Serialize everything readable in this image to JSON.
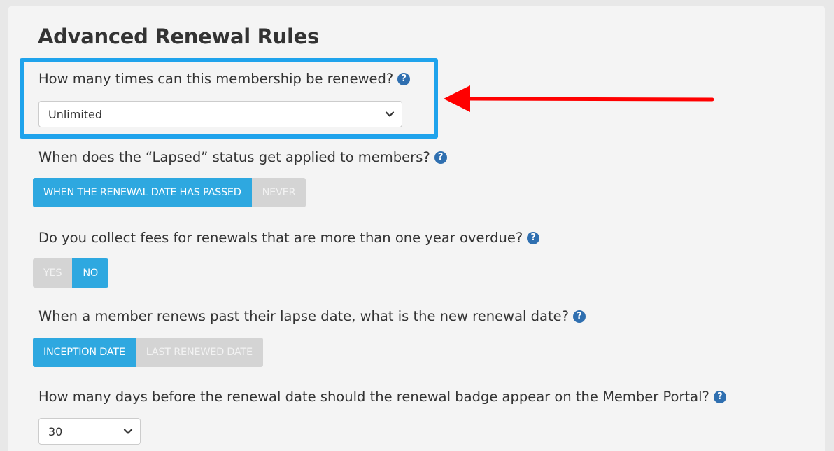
{
  "page": {
    "title": "Advanced Renewal Rules"
  },
  "renewal_limit": {
    "question": "How many times can this membership be renewed?",
    "selected": "Unlimited"
  },
  "lapsed_status": {
    "question": "When does the “Lapsed” status get applied to members?",
    "options": [
      "WHEN THE RENEWAL DATE HAS PASSED",
      "NEVER"
    ],
    "selected": "WHEN THE RENEWAL DATE HAS PASSED"
  },
  "overdue_fees": {
    "question": "Do you collect fees for renewals that are more than one year overdue?",
    "options": [
      "YES",
      "NO"
    ],
    "selected": "NO"
  },
  "new_renewal_date": {
    "question": "When a member renews past their lapse date, what is the new renewal date?",
    "options": [
      "INCEPTION DATE",
      "LAST RENEWED DATE"
    ],
    "selected": "INCEPTION DATE"
  },
  "badge_days": {
    "question": "How many days before the renewal date should the renewal badge appear on the Member Portal?",
    "selected": "30"
  },
  "help_icon_glyph": "?",
  "colors": {
    "accent": "#2ea8e0",
    "inactive": "#d4d4d4",
    "highlight": "#1fa3ec",
    "arrow": "#ff0000",
    "help_icon": "#2f6fb0"
  }
}
